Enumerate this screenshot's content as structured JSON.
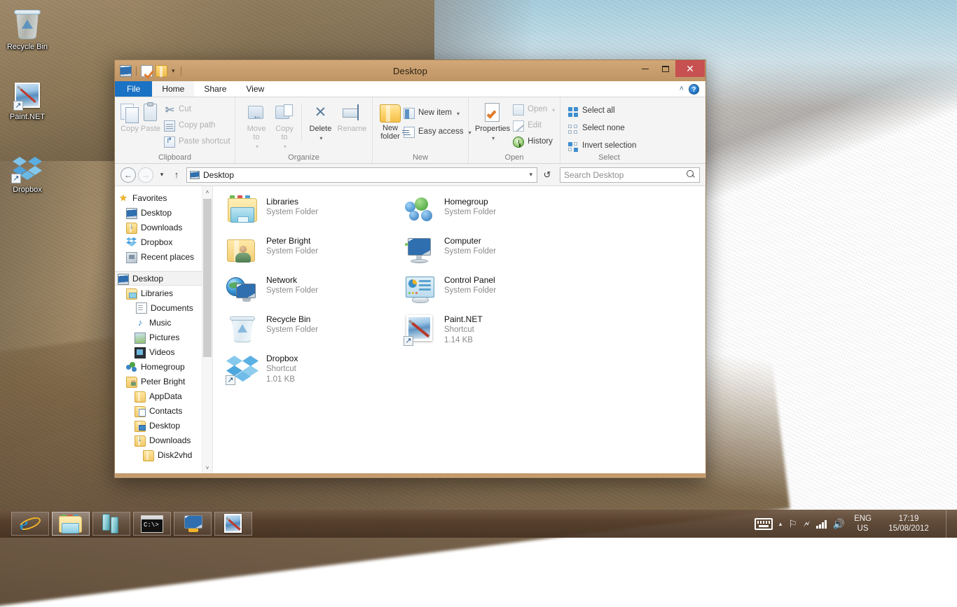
{
  "desktop": {
    "icons": [
      {
        "label": "Recycle Bin",
        "icon": "recycle-bin-icon"
      },
      {
        "label": "Paint.NET",
        "icon": "paintnet-shortcut-icon"
      },
      {
        "label": "Dropbox",
        "icon": "dropbox-shortcut-icon"
      }
    ]
  },
  "window": {
    "title": "Desktop",
    "quick_access": [
      {
        "icon": "this-pc-icon",
        "name": "properties-quick"
      },
      {
        "icon": "properties-icon",
        "name": "properties-quick"
      },
      {
        "icon": "new-folder-icon",
        "name": "new-folder-quick"
      },
      {
        "icon": "chevron-down-icon",
        "name": "customize-quick-access"
      }
    ],
    "controls": {
      "minimize": "–",
      "maximize": "❒",
      "close": "✕"
    }
  },
  "tabs": [
    {
      "label": "File",
      "active": false,
      "style": "file"
    },
    {
      "label": "Home",
      "active": true,
      "style": "normal"
    },
    {
      "label": "Share",
      "active": false,
      "style": "normal"
    },
    {
      "label": "View",
      "active": false,
      "style": "normal"
    }
  ],
  "ribbon": {
    "collapse_icon": "˄",
    "help_icon": "?",
    "groups": [
      {
        "name": "Clipboard",
        "big": [
          {
            "label": "Copy",
            "icon": "copy-icon",
            "disabled": true
          },
          {
            "label": "Paste",
            "icon": "paste-icon",
            "disabled": true
          }
        ],
        "small": [
          {
            "label": "Cut",
            "icon": "scissors-icon",
            "disabled": true
          },
          {
            "label": "Copy path",
            "icon": "copy-path-icon",
            "disabled": true
          },
          {
            "label": "Paste shortcut",
            "icon": "paste-shortcut-icon",
            "disabled": true
          }
        ]
      },
      {
        "name": "Organize",
        "big": [
          {
            "label": "Move\nto",
            "icon": "move-to-icon",
            "disabled": true,
            "dropdown": true
          },
          {
            "label": "Copy\nto",
            "icon": "copy-to-icon",
            "disabled": true,
            "dropdown": true
          },
          {
            "label": "Delete",
            "icon": "delete-x-icon",
            "disabled": false,
            "dropdown": true
          },
          {
            "label": "Rename",
            "icon": "rename-icon",
            "disabled": true
          }
        ],
        "small": []
      },
      {
        "name": "New",
        "big": [
          {
            "label": "New\nfolder",
            "icon": "new-folder-icon",
            "disabled": false
          }
        ],
        "small": [
          {
            "label": "New item",
            "icon": "new-item-icon",
            "disabled": false,
            "dropdown": true
          },
          {
            "label": "Easy access",
            "icon": "easy-access-icon",
            "disabled": false,
            "dropdown": true
          }
        ]
      },
      {
        "name": "Open",
        "big": [
          {
            "label": "Properties",
            "icon": "properties-icon",
            "disabled": false,
            "dropdown": true
          }
        ],
        "small": [
          {
            "label": "Open",
            "icon": "open-icon",
            "disabled": true,
            "dropdown": true
          },
          {
            "label": "Edit",
            "icon": "edit-icon",
            "disabled": true
          },
          {
            "label": "History",
            "icon": "history-icon",
            "disabled": false
          }
        ]
      },
      {
        "name": "Select",
        "big": [],
        "small": [
          {
            "label": "Select all",
            "icon": "select-all-icon",
            "disabled": false
          },
          {
            "label": "Select none",
            "icon": "select-none-icon",
            "disabled": false
          },
          {
            "label": "Invert selection",
            "icon": "invert-selection-icon",
            "disabled": false
          }
        ]
      }
    ]
  },
  "addressbar": {
    "back_icon": "←",
    "forward_icon": "→",
    "recent_icon": "▾",
    "up_icon": "↑",
    "crumb": "Desktop",
    "crumb_dropdown": "▾",
    "refresh_icon": "↺",
    "search_placeholder": "Search Desktop",
    "search_value": ""
  },
  "navpane": {
    "items": [
      {
        "label": "Favorites",
        "depth": 0,
        "icon": "star-icon",
        "selected": false
      },
      {
        "label": "Desktop",
        "depth": 1,
        "icon": "desktop-icon",
        "selected": false
      },
      {
        "label": "Downloads",
        "depth": 1,
        "icon": "downloads-icon",
        "selected": false
      },
      {
        "label": "Dropbox",
        "depth": 1,
        "icon": "dropbox-icon",
        "selected": false
      },
      {
        "label": "Recent places",
        "depth": 1,
        "icon": "recent-places-icon",
        "selected": false
      },
      {
        "label": "Desktop",
        "depth": 0,
        "icon": "desktop-icon",
        "selected": true,
        "spacer_before": true
      },
      {
        "label": "Libraries",
        "depth": 1,
        "icon": "libraries-icon",
        "selected": false
      },
      {
        "label": "Documents",
        "depth": 2,
        "icon": "documents-icon",
        "selected": false
      },
      {
        "label": "Music",
        "depth": 2,
        "icon": "music-icon",
        "selected": false
      },
      {
        "label": "Pictures",
        "depth": 2,
        "icon": "pictures-icon",
        "selected": false
      },
      {
        "label": "Videos",
        "depth": 2,
        "icon": "videos-icon",
        "selected": false
      },
      {
        "label": "Homegroup",
        "depth": 1,
        "icon": "homegroup-icon",
        "selected": false
      },
      {
        "label": "Peter Bright",
        "depth": 1,
        "icon": "user-folder-icon",
        "selected": false
      },
      {
        "label": "AppData",
        "depth": 2,
        "icon": "folder-icon",
        "selected": false
      },
      {
        "label": "Contacts",
        "depth": 2,
        "icon": "contacts-icon",
        "selected": false
      },
      {
        "label": "Desktop",
        "depth": 2,
        "icon": "desktop-folder-icon",
        "selected": false
      },
      {
        "label": "Downloads",
        "depth": 2,
        "icon": "downloads-icon",
        "selected": false
      },
      {
        "label": "Disk2vhd",
        "depth": 3,
        "icon": "folder-icon",
        "selected": false
      }
    ],
    "scroll_up": "˄",
    "scroll_down": "˅"
  },
  "files": {
    "column1": [
      {
        "name": "Libraries",
        "type": "System Folder",
        "size": "",
        "icon": "libraries-icon"
      },
      {
        "name": "Peter Bright",
        "type": "System Folder",
        "size": "",
        "icon": "user-folder-icon"
      },
      {
        "name": "Network",
        "type": "System Folder",
        "size": "",
        "icon": "network-icon"
      },
      {
        "name": "Recycle Bin",
        "type": "System Folder",
        "size": "",
        "icon": "recycle-bin-icon"
      },
      {
        "name": "Dropbox",
        "type": "Shortcut",
        "size": "1.01 KB",
        "icon": "dropbox-icon"
      }
    ],
    "column2": [
      {
        "name": "Homegroup",
        "type": "System Folder",
        "size": "",
        "icon": "homegroup-icon"
      },
      {
        "name": "Computer",
        "type": "System Folder",
        "size": "",
        "icon": "computer-icon"
      },
      {
        "name": "Control Panel",
        "type": "System Folder",
        "size": "",
        "icon": "control-panel-icon"
      },
      {
        "name": "Paint.NET",
        "type": "Shortcut",
        "size": "1.14 KB",
        "icon": "paintnet-icon"
      }
    ]
  },
  "taskbar": {
    "buttons": [
      {
        "name": "internet-explorer",
        "icon": "ie-icon",
        "active": false
      },
      {
        "name": "file-explorer",
        "icon": "explorer-icon",
        "active": true
      },
      {
        "name": "servers",
        "icon": "servers-icon",
        "active": false
      },
      {
        "name": "command-prompt",
        "icon": "cmd-icon",
        "active": false,
        "text": "C:\\>"
      },
      {
        "name": "remote-desktop",
        "icon": "rdp-icon",
        "active": false
      },
      {
        "name": "paint-dotnet",
        "icon": "paintnet-icon",
        "active": false
      }
    ],
    "tray": {
      "keyboard_icon": "keyboard-icon",
      "overflow_icon": "▴",
      "flag_icon": "action-center-icon",
      "usb_icon": "safely-remove-hardware-icon",
      "network_icon": "network-signal-icon",
      "volume_icon": "🔊",
      "lang_line1": "ENG",
      "lang_line2": "US",
      "time": "17:19",
      "date": "15/08/2012"
    }
  }
}
